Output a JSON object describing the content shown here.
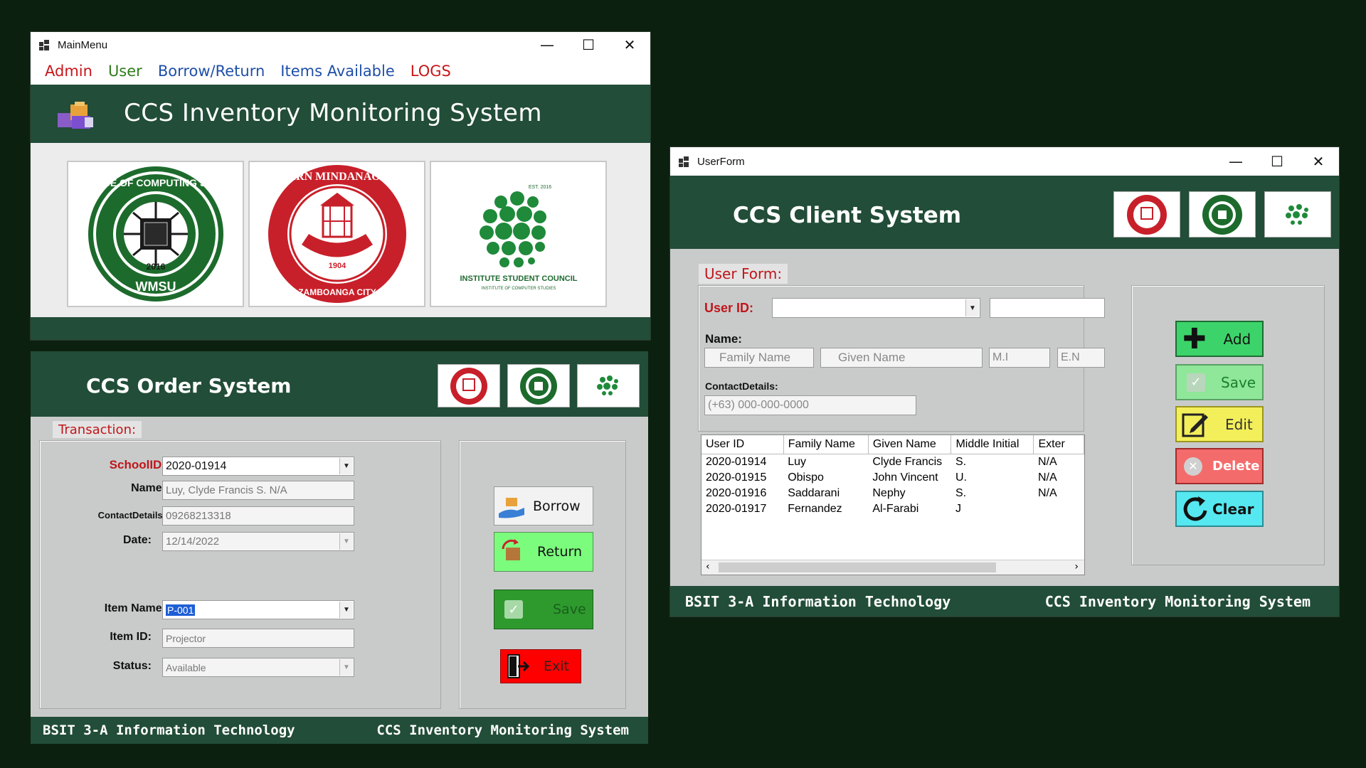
{
  "main_menu": {
    "title": "MainMenu",
    "controls": {
      "minimize": "—",
      "maximize": "☐",
      "close": "✕"
    },
    "menu": [
      {
        "label": "Admin",
        "color": "#c8161a"
      },
      {
        "label": "User",
        "color": "#2e7d1e"
      },
      {
        "label": "Borrow/Return",
        "color": "#1f4fa8"
      },
      {
        "label": "Items Available",
        "color": "#1f4fa8"
      },
      {
        "label": "LOGS",
        "color": "#c8161a"
      }
    ],
    "header_title": "CCS Inventory Monitoring System",
    "logos": [
      {
        "name": "ccs-logo",
        "ring_text": "COLLEGE OF COMPUTING STUDIES",
        "year": "2016",
        "bottom": "WMSU"
      },
      {
        "name": "wmsu-logo",
        "ring_text": "WESTERN MINDANAO STATE UNIVERSITY",
        "year": "1904",
        "bottom": "ZAMBOANGA CITY"
      },
      {
        "name": "isc-logo",
        "caption": "INSTITUTE STUDENT COUNCIL",
        "sub": "INSTITUTE OF COMPUTER STUDIES",
        "est": "EST. 2016"
      }
    ]
  },
  "order_form": {
    "header_title": "CCS Order System",
    "tab": "Transaction:",
    "fields": {
      "school_id": {
        "label": "SchoolID:",
        "value": "2020-01914"
      },
      "name": {
        "label": "Name:",
        "value": "Luy, Clyde Francis S. N/A"
      },
      "contact": {
        "label": "ContactDetails:",
        "value": "09268213318"
      },
      "date": {
        "label": "Date:",
        "value": "12/14/2022"
      },
      "item_name": {
        "label": "Item Name:",
        "value": "P-001"
      },
      "item_id": {
        "label": "Item ID:",
        "value": "Projector"
      },
      "status": {
        "label": "Status:",
        "value": "Available"
      }
    },
    "buttons": {
      "borrow": "Borrow",
      "return": "Return",
      "save": "Save",
      "exit": "Exit"
    },
    "footer_left": "BSIT 3-A Information Technology",
    "footer_right": "CCS Inventory Monitoring System"
  },
  "user_form": {
    "title": "UserForm",
    "controls": {
      "minimize": "—",
      "maximize": "☐",
      "close": "✕"
    },
    "header_title": "CCS Client System",
    "tab": "User Form:",
    "user_id_label": "User ID:",
    "name_label": "Name:",
    "placeholders": {
      "family": "Family Name",
      "given": "Given Name",
      "mi": "M.I",
      "en": "E.N",
      "contact": "(+63) 000-000-0000"
    },
    "contact_label": "ContactDetails:",
    "table": {
      "columns": [
        "User ID",
        "Family Name",
        "Given Name",
        "Middle Initial",
        "Exter"
      ],
      "rows": [
        [
          "2020-01914",
          "Luy",
          "Clyde Francis",
          "S.",
          "N/A"
        ],
        [
          "2020-01915",
          "Obispo",
          "John Vincent",
          "U.",
          "N/A"
        ],
        [
          "2020-01916",
          "Saddarani",
          "Nephy",
          "S.",
          "N/A"
        ],
        [
          "2020-01917",
          "Fernandez",
          "Al-Farabi",
          "J",
          ""
        ]
      ]
    },
    "buttons": {
      "add": "Add",
      "save": "Save",
      "edit": "Edit",
      "delete": "Delete",
      "clear": "Clear"
    },
    "footer_left": "BSIT 3-A Information Technology",
    "footer_right": "CCS Inventory Monitoring System"
  },
  "colors": {
    "form_green": "#224d38",
    "background": "#0c200f",
    "label_red": "#c0161a"
  }
}
